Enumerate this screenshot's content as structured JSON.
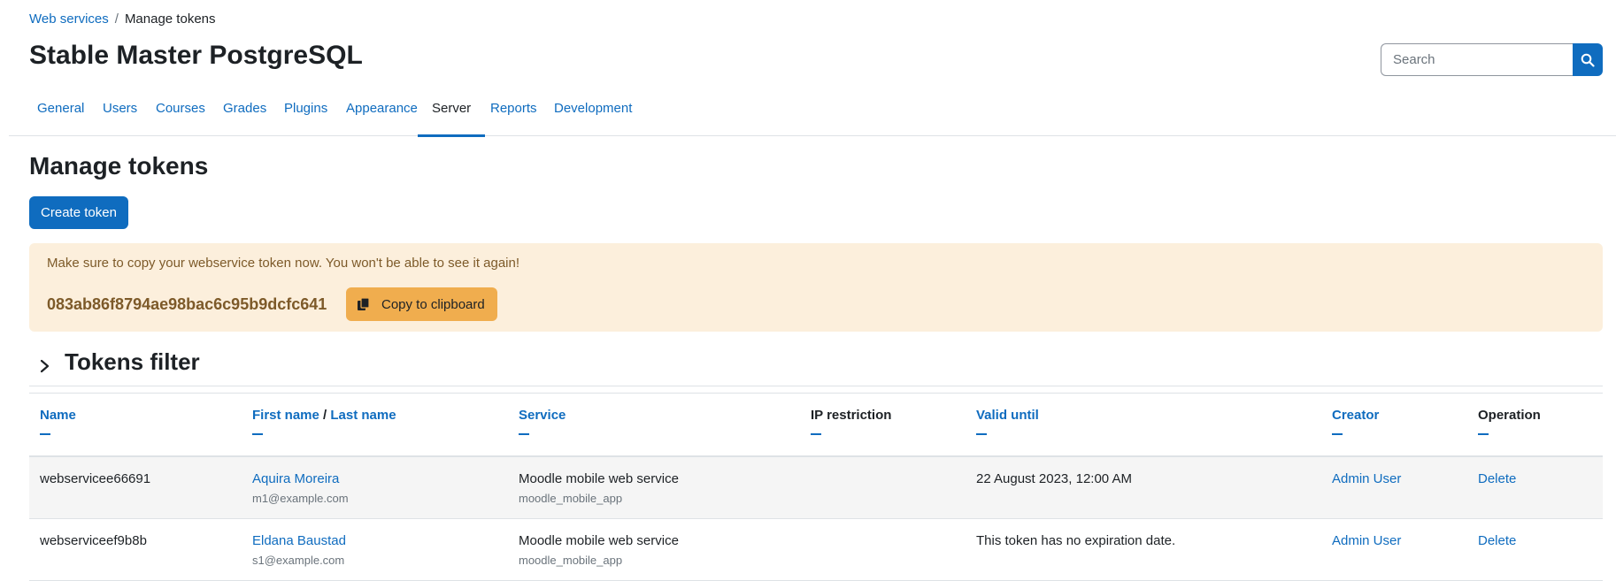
{
  "breadcrumb": {
    "parent": "Web services",
    "separator": "/",
    "current": "Manage tokens"
  },
  "site_title": "Stable Master PostgreSQL",
  "search": {
    "placeholder": "Search"
  },
  "tabs": [
    "General",
    "Users",
    "Courses",
    "Grades",
    "Plugins",
    "Appearance",
    "Server",
    "Reports",
    "Development"
  ],
  "active_tab": "Server",
  "page_title": "Manage tokens",
  "create_button": "Create token",
  "alert": {
    "message": "Make sure to copy your webservice token now. You won't be able to see it again!",
    "token": "083ab86f8794ae98bac6c95b9dcfc641",
    "copy_label": "Copy to clipboard"
  },
  "filter": {
    "title": "Tokens filter"
  },
  "table": {
    "headers": {
      "name": "Name",
      "first_name": "First name",
      "name_sep": " / ",
      "last_name": "Last name",
      "service": "Service",
      "ip": "IP restriction",
      "valid": "Valid until",
      "creator": "Creator",
      "operation": "Operation"
    },
    "rows": [
      {
        "name": "webserviceе66691",
        "user": "Aquira Moreira",
        "email": "m1@example.com",
        "service": "Moodle mobile web service",
        "service_short": "moodle_mobile_app",
        "ip": "",
        "valid": "22 August 2023, 12:00 AM",
        "creator": "Admin User",
        "operation": "Delete"
      },
      {
        "name": "webserviceef9b8b",
        "user": "Eldana Baustad",
        "email": "s1@example.com",
        "service": "Moodle mobile web service",
        "service_short": "moodle_mobile_app",
        "ip": "",
        "valid": "This token has no expiration date.",
        "creator": "Admin User",
        "operation": "Delete"
      }
    ]
  },
  "colors": {
    "primary": "#0f6cbf",
    "alert_bg": "#fcefdc",
    "alert_text": "#7d5a29",
    "copy_btn": "#f0ad4e"
  }
}
